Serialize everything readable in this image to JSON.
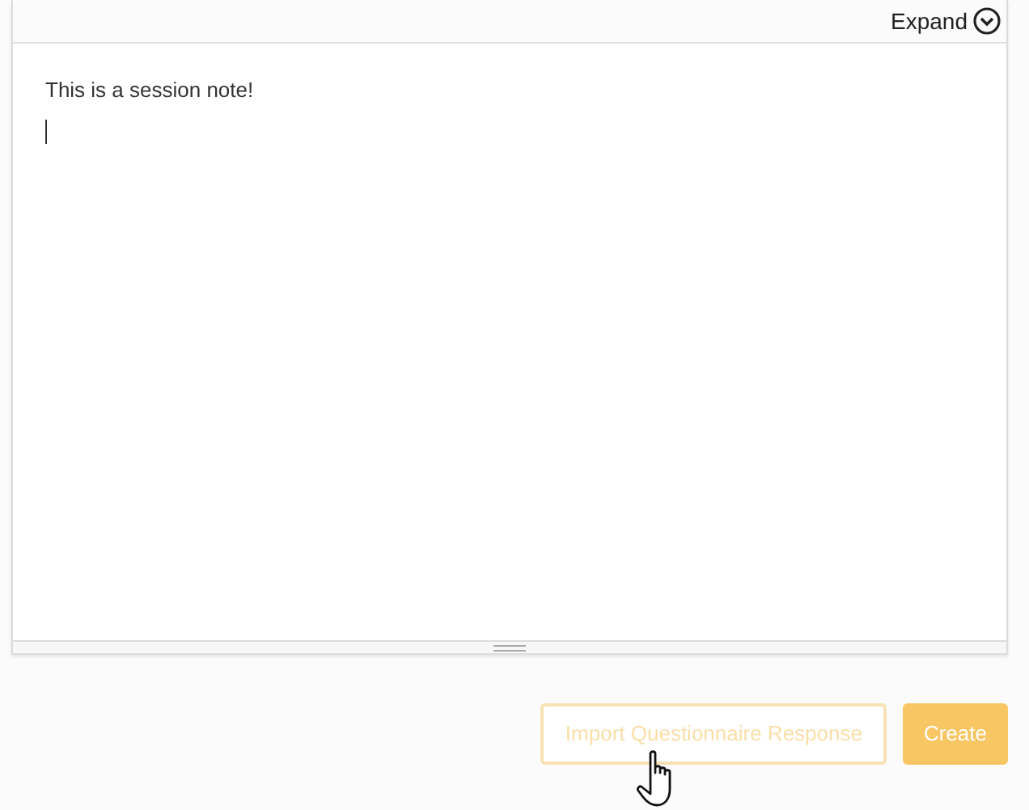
{
  "editor": {
    "expand_label": "Expand",
    "content": "This is a session note!"
  },
  "buttons": [
    {
      "label": "Import Questionnaire Response",
      "kind": "outline",
      "disabled": true
    },
    {
      "label": "Create",
      "kind": "primary",
      "disabled": false
    }
  ]
}
